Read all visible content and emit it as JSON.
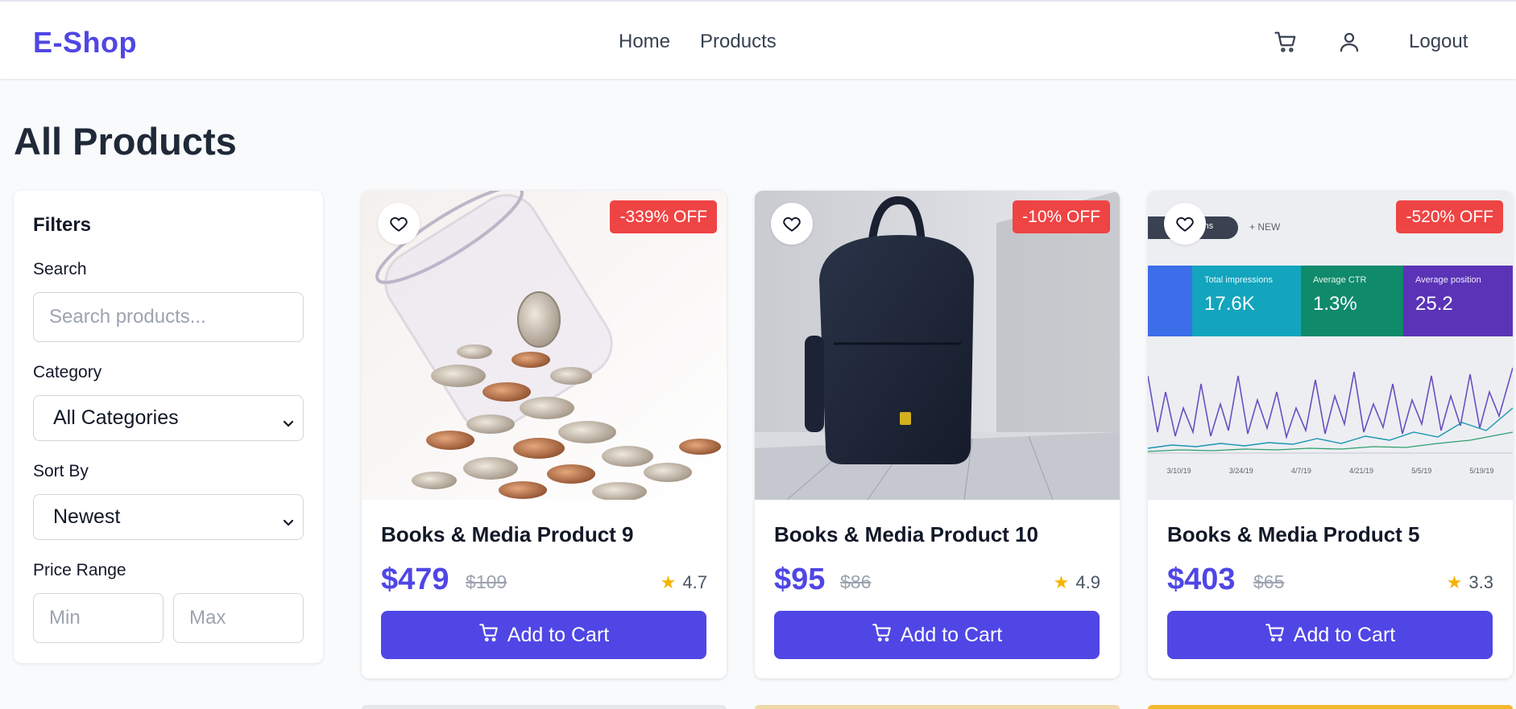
{
  "header": {
    "brand": "E-Shop",
    "nav": [
      "Home",
      "Products"
    ],
    "cart_icon": "cart-icon",
    "user_icon": "user-icon",
    "logout_label": "Logout"
  },
  "page_title": "All Products",
  "filters": {
    "title": "Filters",
    "search_label": "Search",
    "search_placeholder": "Search products...",
    "category_label": "Category",
    "category_selected": "All Categories",
    "sort_label": "Sort By",
    "sort_selected": "Newest",
    "price_label": "Price Range",
    "min_placeholder": "Min",
    "max_placeholder": "Max"
  },
  "products": [
    {
      "name": "Books & Media Product 9",
      "price": "$479",
      "old_price": "$109",
      "rating": "4.7",
      "badge": "-339% OFF",
      "button": "Add to Cart"
    },
    {
      "name": "Books & Media Product 10",
      "price": "$95",
      "old_price": "$86",
      "rating": "4.9",
      "badge": "-10% OFF",
      "button": "Add to Cart"
    },
    {
      "name": "Books & Media Product 5",
      "price": "$403",
      "old_price": "$65",
      "rating": "3.3",
      "badge": "-520% OFF",
      "button": "Add to Cart"
    }
  ],
  "analytics_image": {
    "chip": "Months",
    "new_label": "NEW",
    "metrics": [
      {
        "label": "Total impressions",
        "value": "17.6K"
      },
      {
        "label": "Average CTR",
        "value": "1.3%"
      },
      {
        "label": "Average position",
        "value": "25.2"
      }
    ],
    "dates": [
      "3/10/19",
      "3/24/19",
      "4/7/19",
      "4/21/19",
      "5/5/19",
      "5/19/19"
    ]
  },
  "colors": {
    "brand": "#4f46e5",
    "badge": "#ef4444",
    "star": "#f5b400"
  }
}
